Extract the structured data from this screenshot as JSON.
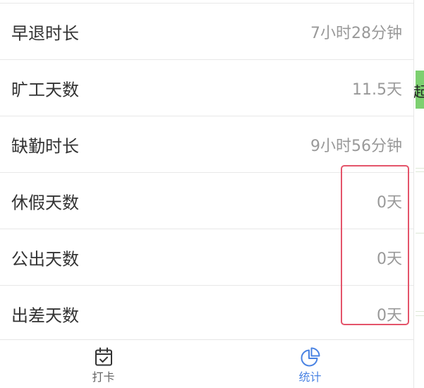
{
  "stats": {
    "rows": [
      {
        "label": "早退时长",
        "value": "7小时28分钟"
      },
      {
        "label": "旷工天数",
        "value": "11.5天"
      },
      {
        "label": "缺勤时长",
        "value": "9小时56分钟"
      },
      {
        "label": "休假天数",
        "value": "0天"
      },
      {
        "label": "公出天数",
        "value": "0天"
      },
      {
        "label": "出差天数",
        "value": "0天"
      }
    ]
  },
  "highlight": {
    "color": "#e4546a"
  },
  "tabbar": {
    "tabs": [
      {
        "label": "打卡",
        "icon": "calendar-check-icon",
        "active": false
      },
      {
        "label": "统计",
        "icon": "pie-chart-icon",
        "active": true
      }
    ],
    "active_color": "#4a83e3",
    "inactive_color": "#666666"
  },
  "background": {
    "button_partial_text": "起",
    "button_color": "#7dd070"
  }
}
